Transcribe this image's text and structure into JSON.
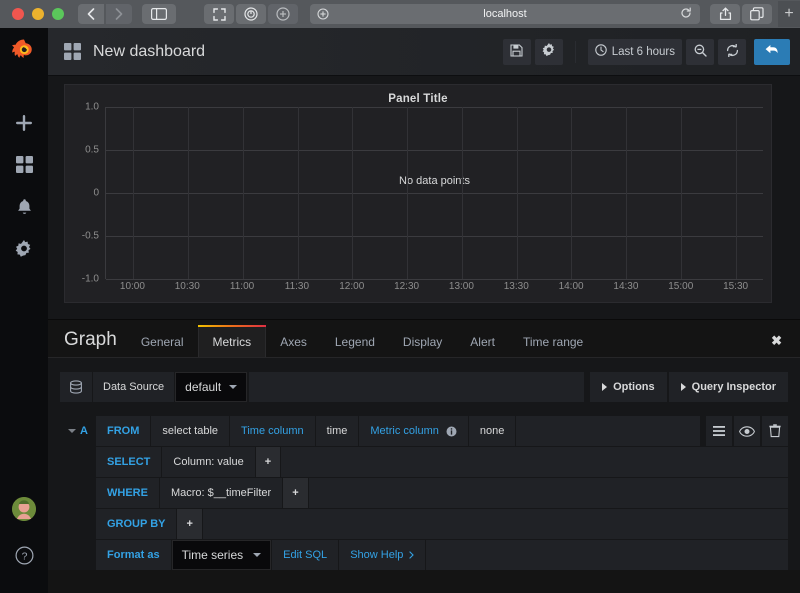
{
  "browser": {
    "url": "localhost",
    "icons": {
      "back": "back-chevron-icon",
      "forward": "forward-chevron-icon",
      "sidebar": "sidebar-toggle-icon",
      "fullscreen": "fullscreen-icon",
      "reader": "reader-view-icon",
      "zoom": "page-zoom-icon",
      "reload": "reload-icon",
      "share": "share-icon",
      "tabs": "tab-overview-icon",
      "newtab": "+"
    }
  },
  "sidebar": {
    "logo": "grafana-logo-icon",
    "items": [
      {
        "name": "create",
        "icon": "plus-icon"
      },
      {
        "name": "dashboards",
        "icon": "dashboards-icon"
      },
      {
        "name": "alerting",
        "icon": "bell-icon"
      },
      {
        "name": "configuration",
        "icon": "gear-icon"
      }
    ],
    "bottom": [
      {
        "name": "user-avatar",
        "icon": "avatar-icon"
      },
      {
        "name": "help",
        "icon": "question-mark-icon"
      }
    ]
  },
  "navbar": {
    "dashboard_icon": "dashboard-grid-icon",
    "title": "New dashboard",
    "buttons": {
      "save": "save-icon",
      "settings": "gear-icon",
      "time_range": "Last 6 hours",
      "time_icon": "clock-icon",
      "zoom_out": "zoom-out-icon",
      "refresh": "refresh-icon",
      "back": "back-arrow-icon"
    }
  },
  "panel": {
    "title": "Panel Title",
    "no_data": "No data points"
  },
  "chart_data": {
    "type": "line",
    "title": "Panel Title",
    "xlabel": "",
    "ylabel": "",
    "series": [
      {
        "name": "A",
        "values": []
      }
    ],
    "x_ticks": [
      "10:00",
      "10:30",
      "11:00",
      "11:30",
      "12:00",
      "12:30",
      "13:00",
      "13:30",
      "14:00",
      "14:30",
      "15:00",
      "15:30"
    ],
    "y_ticks": [
      "1.0",
      "0.5",
      "0",
      "-0.5",
      "-1.0"
    ],
    "ylim": [
      -1.0,
      1.0
    ],
    "grid": true,
    "legend": false,
    "annotation": "No data points"
  },
  "editor": {
    "title": "Graph",
    "tabs": [
      {
        "label": "General",
        "active": false
      },
      {
        "label": "Metrics",
        "active": true
      },
      {
        "label": "Axes",
        "active": false
      },
      {
        "label": "Legend",
        "active": false
      },
      {
        "label": "Display",
        "active": false
      },
      {
        "label": "Alert",
        "active": false
      },
      {
        "label": "Time range",
        "active": false
      }
    ],
    "close": "✖",
    "datasource": {
      "icon": "database-icon",
      "label": "Data Source",
      "value": "default",
      "options_label": "Options",
      "query_inspector_label": "Query Inspector"
    },
    "query": {
      "ref": "A",
      "from_label": "FROM",
      "table_value": "select table",
      "time_column_label": "Time column",
      "time_column_value": "time",
      "metric_column_label": "Metric column",
      "metric_column_value": "none",
      "metric_column_info": "info-icon",
      "select_label": "SELECT",
      "select_value": "Column: value",
      "where_label": "WHERE",
      "where_value": "Macro: $__timeFilter",
      "group_by_label": "GROUP BY",
      "add": "+",
      "format_as_label": "Format as",
      "format_as_value": "Time series",
      "edit_sql_label": "Edit SQL",
      "show_help_label": "Show Help",
      "actions": {
        "menu": "hamburger-icon",
        "toggle": "eye-icon",
        "delete": "trash-icon"
      }
    }
  },
  "colors": {
    "accent_blue": "#33a2e5",
    "primary_button": "#2b7cb5",
    "tab_gradient_start": "#f2c200",
    "tab_gradient_end": "#e02f44",
    "panel_bg": "#212124",
    "app_bg": "#161719"
  }
}
